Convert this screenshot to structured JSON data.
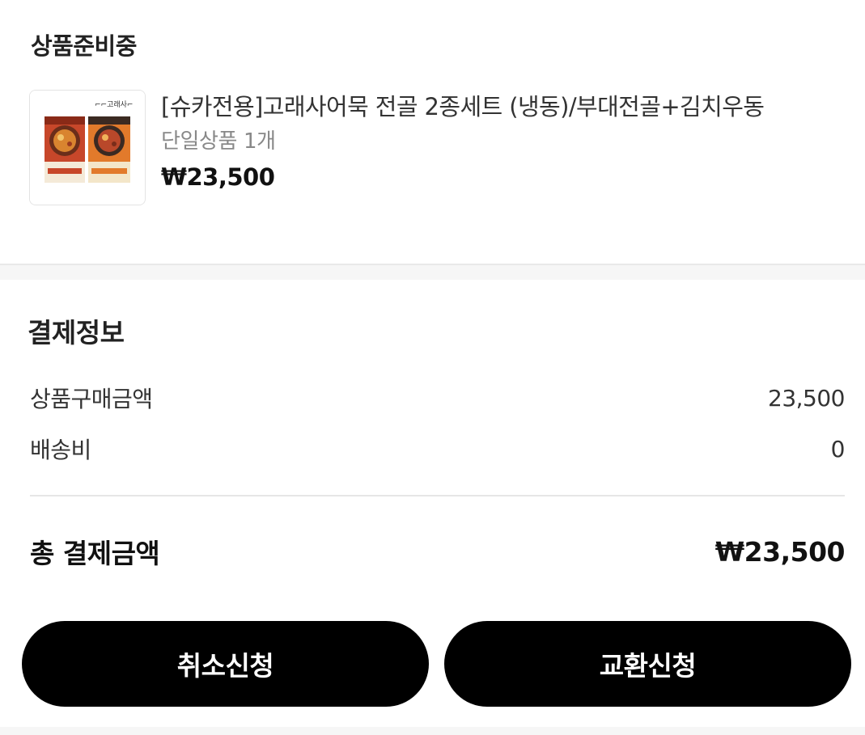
{
  "order": {
    "status": "상품준비중",
    "product": {
      "name": "[슈카전용]고래사어묵 전골 2종세트 (냉동)/부대전골+김치우동",
      "option": "단일상품 1개",
      "price": "₩23,500",
      "image": "product-pack-image"
    }
  },
  "payment": {
    "title": "결제정보",
    "rows": [
      {
        "label": "상품구매금액",
        "value": "23,500"
      },
      {
        "label": "배송비",
        "value": "0"
      }
    ],
    "total_label": "총 결제금액",
    "total_value": "₩23,500"
  },
  "buttons": {
    "cancel": "취소신청",
    "exchange": "교환신청"
  },
  "colors": {
    "button_bg": "#000000",
    "button_text": "#ffffff",
    "divider": "#e6e6e6",
    "section_gap": "#f6f6f6"
  }
}
